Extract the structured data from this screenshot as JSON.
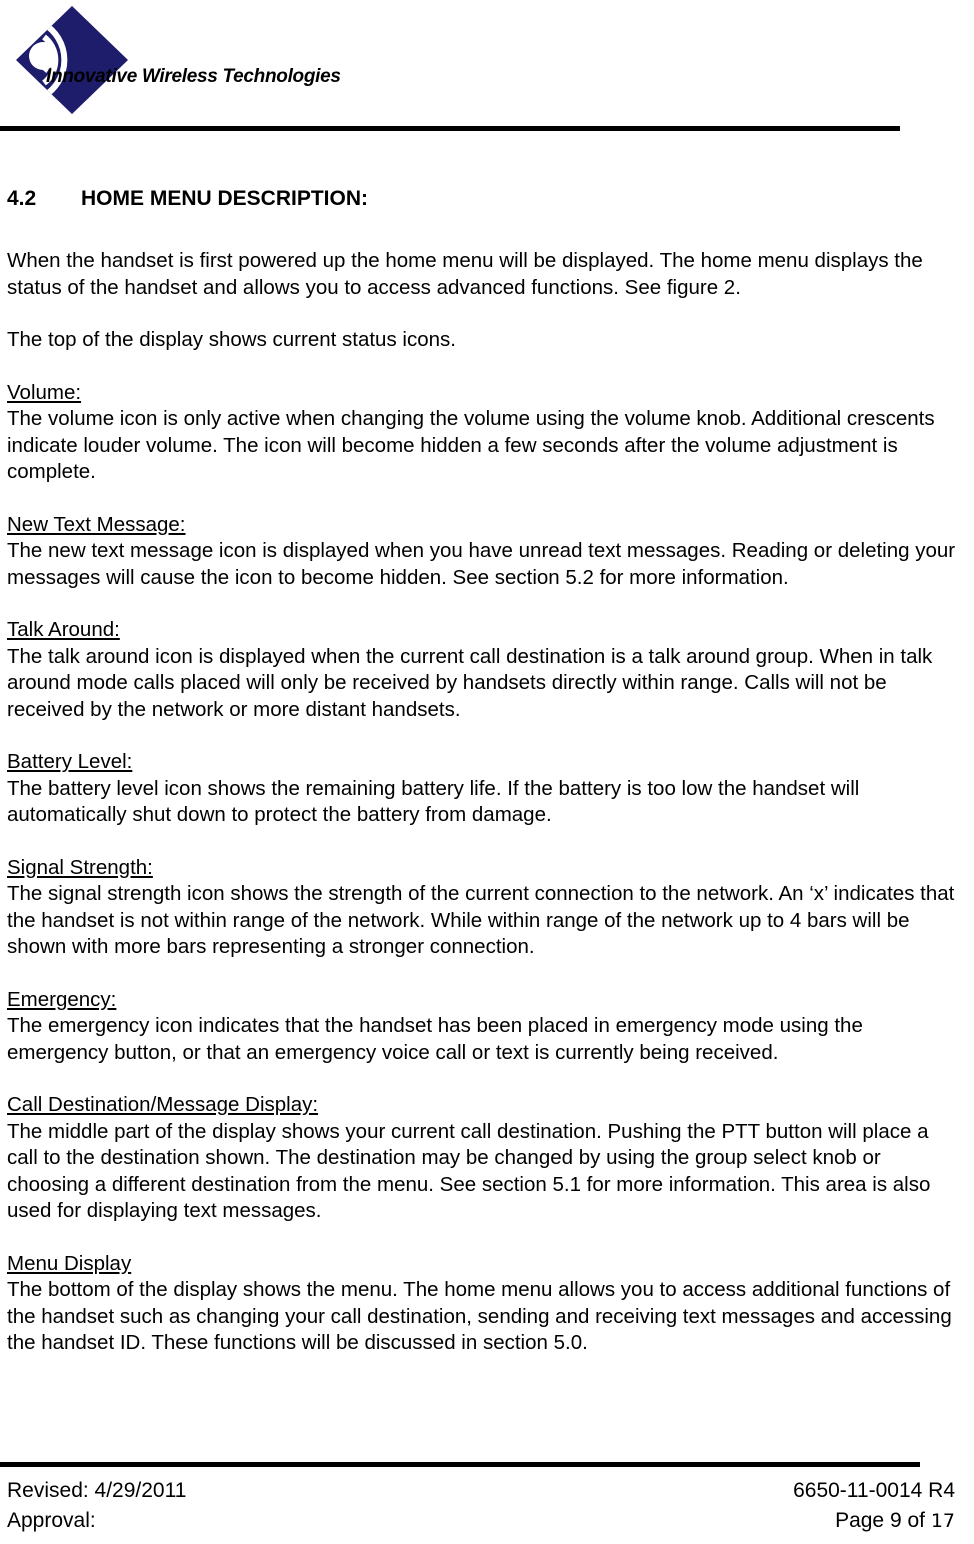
{
  "header": {
    "logo_icon": "wireless-waves-diamond-logo",
    "company_name": "Innovative Wireless Technologies"
  },
  "section": {
    "number": "4.2",
    "title": "HOME MENU DESCRIPTION:"
  },
  "intro": {
    "paragraph1": "When the handset is first powered up the home menu will be displayed.  The home menu displays the status of the handset and allows you to access advanced functions. See figure 2.",
    "paragraph2": "The top of the display shows current status icons."
  },
  "topics": [
    {
      "heading": "Volume:",
      "body": "The volume icon is only active when changing the volume using the volume knob.  Additional crescents indicate louder volume.  The icon will become hidden a few seconds after the volume adjustment is complete."
    },
    {
      "heading": "New Text Message:",
      "body": "The new text message icon is displayed when you have unread text messages.  Reading or deleting your messages will cause the icon to become hidden.  See section 5.2 for more information."
    },
    {
      "heading": "Talk Around:",
      "body": "The talk around icon is displayed when the current call destination is a talk around group.  When in talk around mode calls placed will only be received by handsets directly within range.  Calls will not be received by the network or more distant handsets."
    },
    {
      "heading": "Battery Level:",
      "body": "The battery level icon shows the remaining battery life.  If the battery is too low the handset will automatically shut down to protect the battery from damage."
    },
    {
      "heading": "Signal Strength:",
      "body": "The signal strength icon shows the strength of the current connection to the network.  An ‘x’ indicates that the handset is not within range of the network.  While within range of the network up to 4 bars will be shown with more bars representing a stronger connection."
    },
    {
      "heading": "Emergency:",
      "body": "The emergency icon indicates that the handset has been placed in emergency mode using the emergency button, or that an emergency voice call or text is currently being received."
    },
    {
      "heading": "Call Destination/Message Display:",
      "body": "The middle part of the display shows your current call destination.  Pushing the PTT button will place a call to the destination shown.  The destination may be changed by using the group select knob or choosing a different destination from the menu.  See section 5.1 for more information. This area is also used for displaying text messages."
    },
    {
      "heading": "Menu Display",
      "body": "The bottom of the display shows the menu.  The home menu allows you to access additional functions of the handset such as changing your call destination, sending and receiving text messages and accessing the handset ID.  These functions will be discussed in section 5.0."
    }
  ],
  "footer": {
    "revised_label": "Revised: 4/29/2011",
    "approval_label": "Approval:",
    "document_number": "6650-11-0014 R4",
    "page_prefix": "Page 9 of ",
    "page_total": "17"
  }
}
